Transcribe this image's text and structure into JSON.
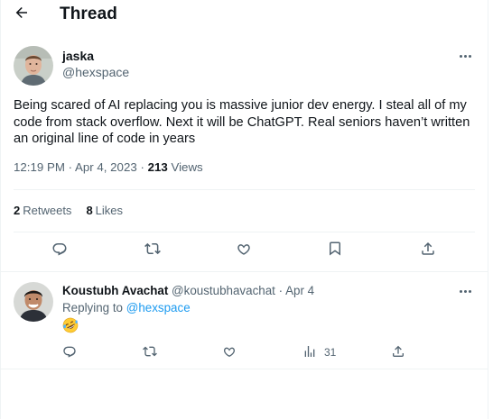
{
  "header": {
    "title": "Thread"
  },
  "tweet": {
    "author": {
      "name": "jaska",
      "handle": "@hexspace"
    },
    "text": "Being scared of AI replacing you is massive junior dev energy. I steal all of my code from stack overflow. Next it will be ChatGPT. Real seniors haven’t written an original line of code in years",
    "timestamp": "12:19 PM · Apr 4, 2023",
    "separator": " · ",
    "views_count": "213",
    "views_label": "Views",
    "retweets_count": "2",
    "retweets_label": "Retweets",
    "likes_count": "8",
    "likes_label": "Likes",
    "actions": [
      "reply-icon",
      "retweet-icon",
      "like-icon",
      "bookmark-icon",
      "share-icon"
    ]
  },
  "reply": {
    "author": {
      "name": "Koustubh Avachat",
      "handle": "@koustubhavachat"
    },
    "dot": "·",
    "date": "Apr 4",
    "replying_prefix": "Replying to",
    "replying_to": "@hexspace",
    "emoji": "rolling-on-floor-laughing-emoji",
    "views_count": "31",
    "actions": [
      "reply-icon",
      "retweet-icon",
      "like-icon",
      "views-icon",
      "share-icon"
    ]
  },
  "colors": {
    "accent": "#1d9bf0",
    "text": "#0f1419",
    "muted": "#536471",
    "border": "#eff3f4"
  }
}
